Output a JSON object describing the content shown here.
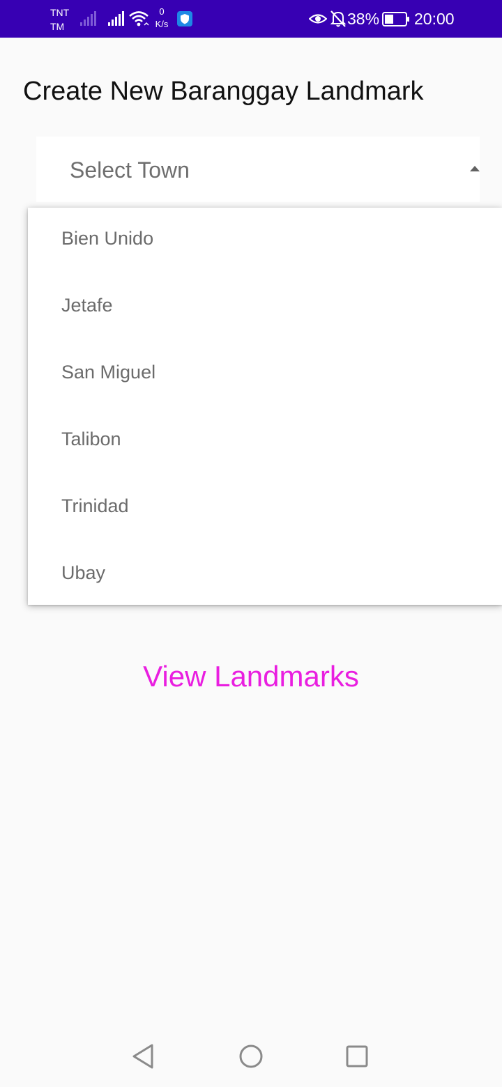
{
  "status_bar": {
    "carrier_line1": "TNT",
    "carrier_line2": "TM",
    "net_speed_value": "0",
    "net_speed_unit": "K/s",
    "battery_percent": "38%",
    "time": "20:00"
  },
  "title": "Create New Baranggay Landmark",
  "spinner": {
    "placeholder": "Select Town"
  },
  "dropdown": {
    "items": [
      {
        "label": "Bien Unido"
      },
      {
        "label": "Jetafe"
      },
      {
        "label": "San Miguel"
      },
      {
        "label": "Talibon"
      },
      {
        "label": "Trinidad"
      },
      {
        "label": "Ubay"
      }
    ]
  },
  "view_landmarks_label": "View Landmarks",
  "colors": {
    "status_bar": "#3700b3",
    "background": "#fafafa",
    "accent": "#e91ee0"
  },
  "icons": {
    "status": [
      "signal-weak-icon",
      "signal-icon",
      "wifi-icon",
      "shield-icon",
      "eye-icon",
      "bell-off-icon",
      "battery-icon"
    ],
    "nav": [
      "back-icon",
      "home-icon",
      "recents-icon"
    ]
  }
}
